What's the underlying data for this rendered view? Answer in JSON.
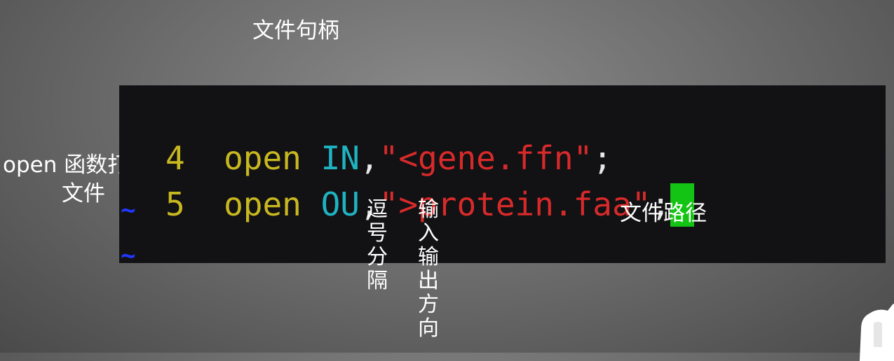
{
  "annotations": {
    "file_handle": "文件句柄",
    "open_function": "open 函数打开",
    "open_function_line2": "文件",
    "comma_separator": "逗号分隔",
    "io_direction": "输入输出方向",
    "file_path": "文件路径"
  },
  "editor": {
    "lines": [
      {
        "number": "4",
        "keyword": "open",
        "handle": "IN",
        "comma": ",",
        "string": "\"<gene.ffn\"",
        "semicolon": ";"
      },
      {
        "number": "5",
        "keyword": "open",
        "handle": "OU",
        "comma": ",",
        "string": "\">protein.faa\"",
        "semicolon": ";"
      }
    ],
    "empty_line_marker": "~",
    "colors": {
      "background": "#121114",
      "line_number": "#c8b820",
      "keyword": "#c8b820",
      "file_handle": "#1fb3c2",
      "string": "#d82a2a",
      "cursor": "#14c414",
      "tilde": "#2038ff"
    }
  },
  "logo_icon": "white-logo-icon"
}
